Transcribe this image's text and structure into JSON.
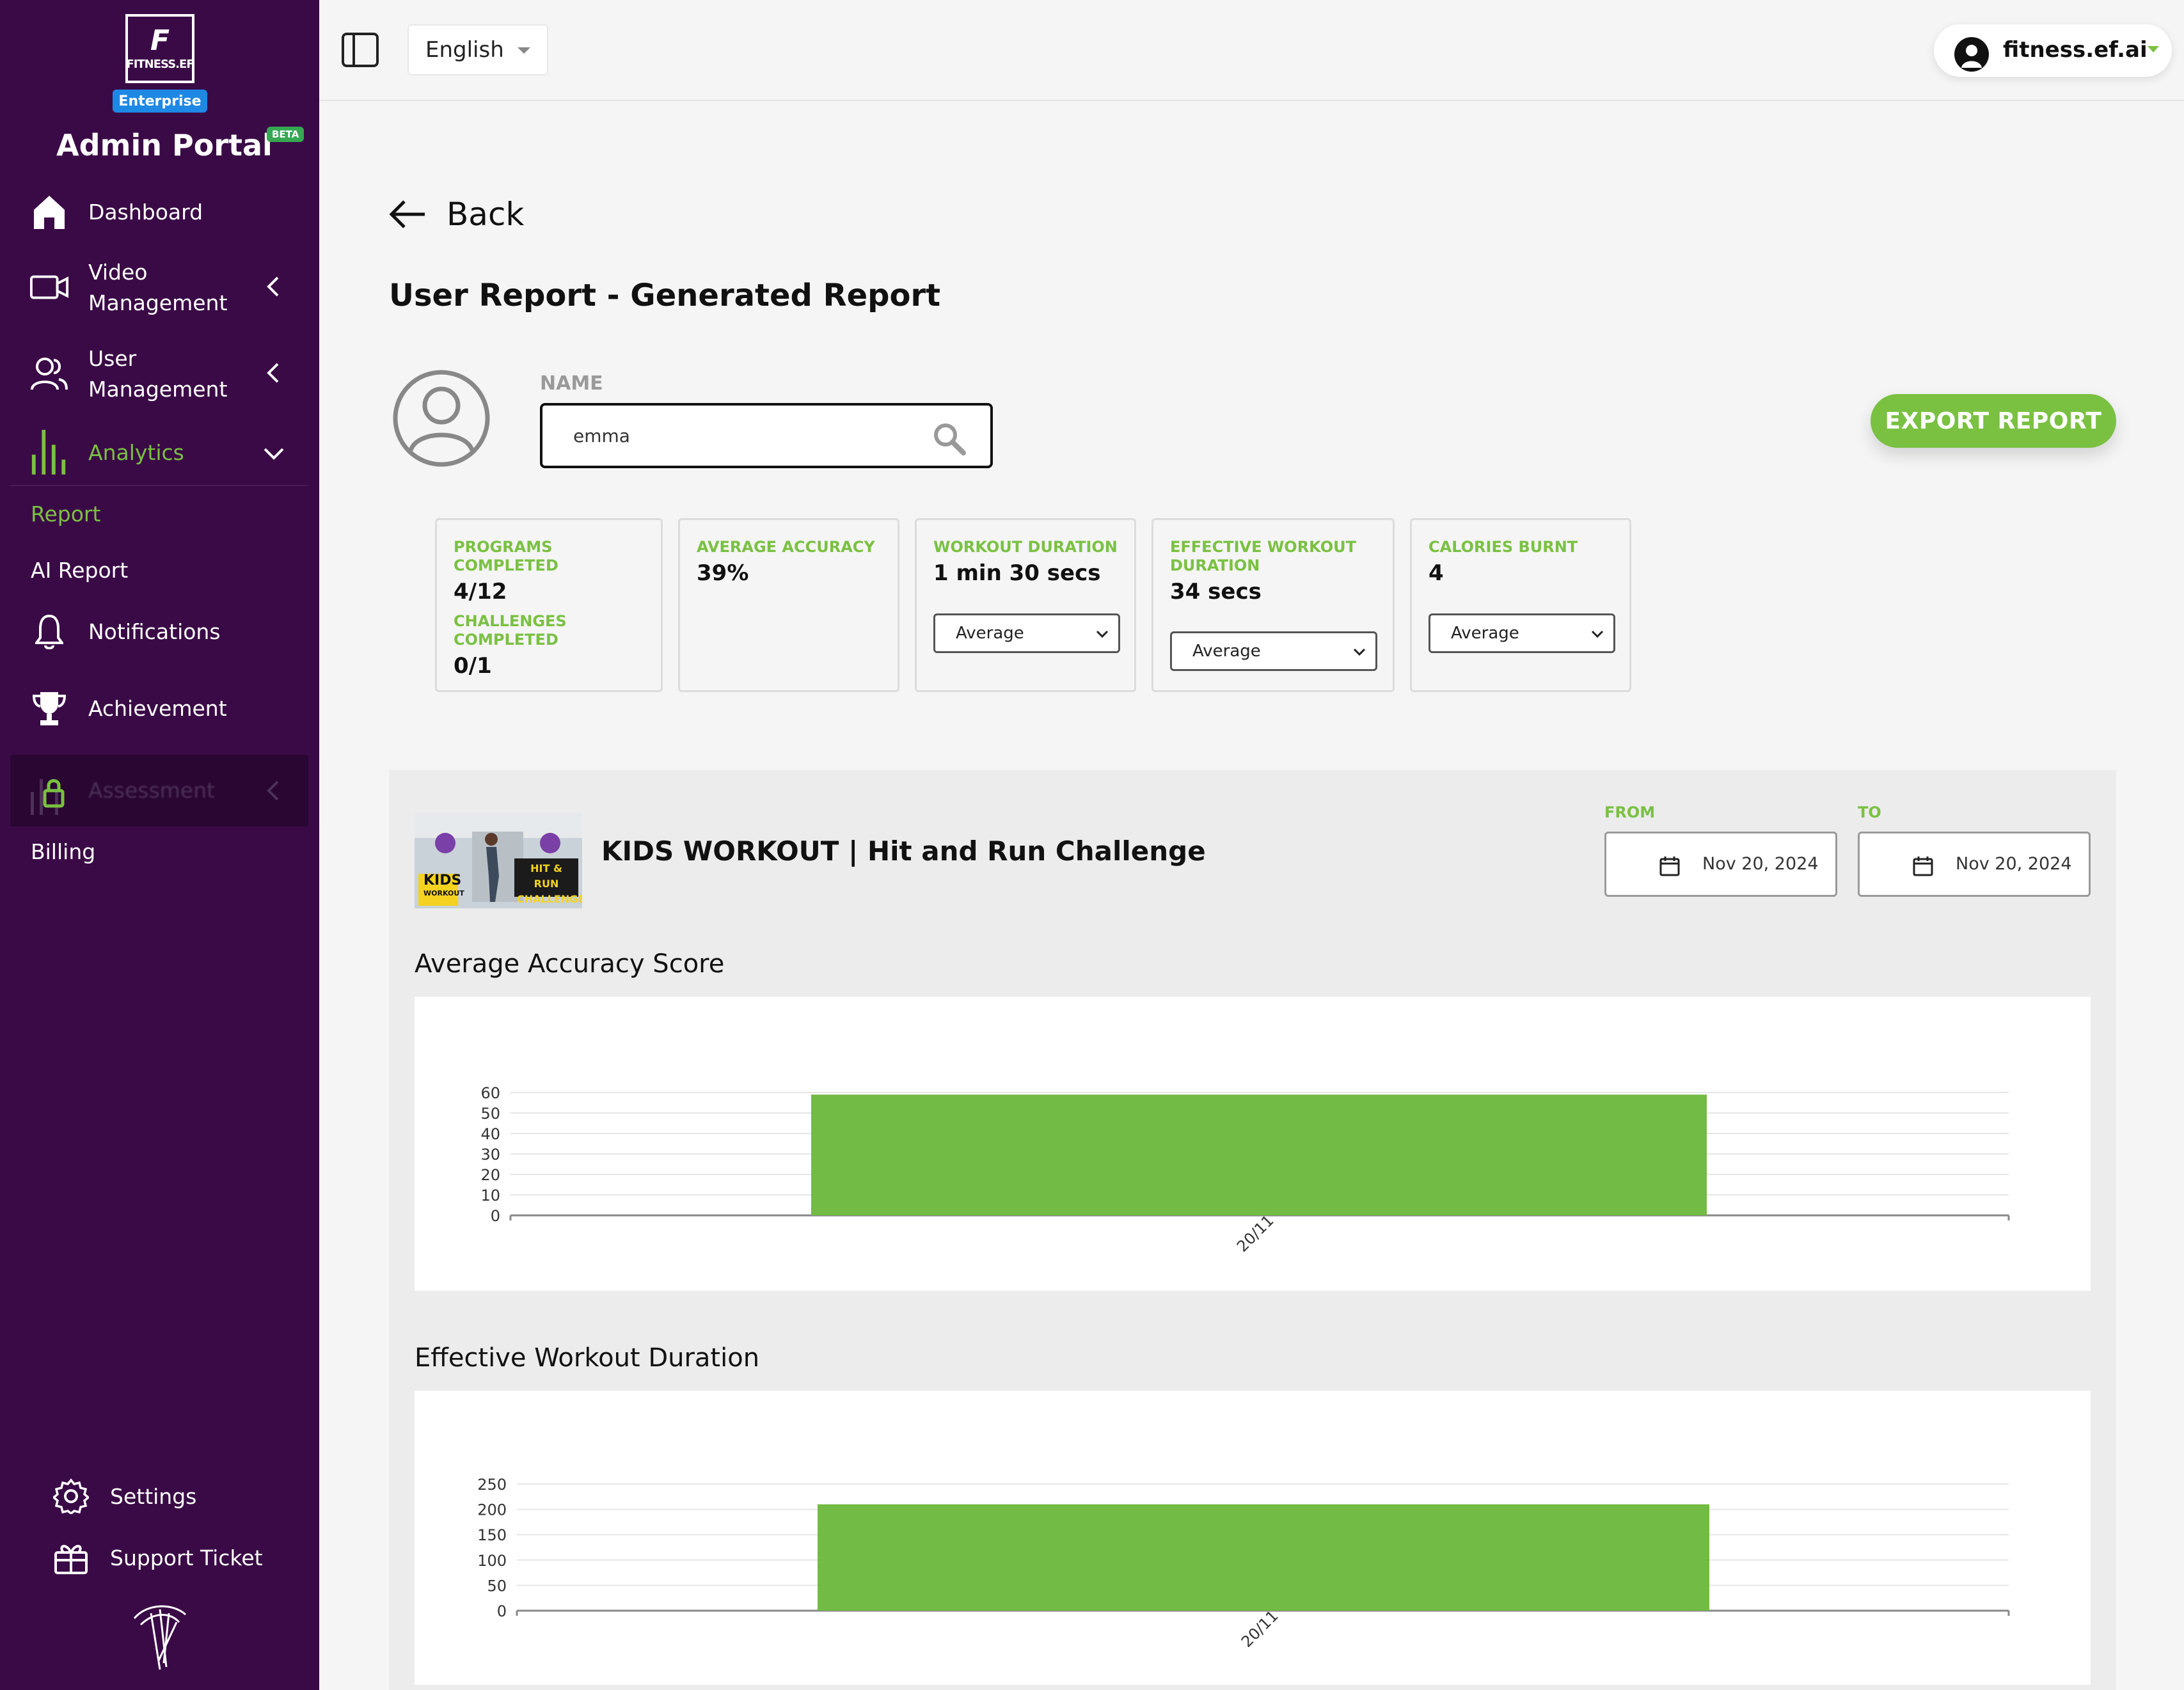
{
  "sidebar": {
    "logo_letter": "F",
    "logo_text": "FITNESS.EF",
    "enterprise_badge": "Enterprise",
    "portal_title": "Admin Portal",
    "beta_badge": "BETA",
    "items": [
      {
        "label": "Dashboard",
        "icon": "home-icon"
      },
      {
        "label": "Video\nManagement",
        "icon": "video-camera-icon"
      },
      {
        "label": "User\nManagement",
        "icon": "users-icon"
      },
      {
        "label": "Analytics",
        "icon": "bar-chart-icon"
      },
      {
        "label": "Report"
      },
      {
        "label": "AI Report"
      },
      {
        "label": "Notifications",
        "icon": "bell-icon"
      },
      {
        "label": "Achievement",
        "icon": "trophy-icon"
      },
      {
        "label": "Assessment",
        "icon": "lock-icon"
      },
      {
        "label": "Billing"
      }
    ],
    "bottom_items": [
      {
        "label": "Settings",
        "icon": "gear-icon"
      },
      {
        "label": "Support Ticket",
        "icon": "gift-icon"
      }
    ],
    "accent_color": "#7ac142",
    "bg_color": "#3a0a46"
  },
  "topbar": {
    "language": "English",
    "account_name": "fitness.ef.ai"
  },
  "main": {
    "back_label": "Back",
    "page_title": "User Report - Generated Report",
    "name_label": "NAME",
    "name_value": "emma",
    "export_label": "EXPORT REPORT",
    "stats": {
      "programs_label": "PROGRAMS COMPLETED",
      "programs_value": "4/12",
      "challenges_label": "CHALLENGES COMPLETED",
      "challenges_value": "0/1",
      "accuracy_label": "AVERAGE ACCURACY",
      "accuracy_value": "39%",
      "duration_label": "WORKOUT DURATION",
      "duration_value": "1 min 30 secs",
      "duration_select": "Average",
      "effective_label": "EFFECTIVE WORKOUT DURATION",
      "effective_value": "34 secs",
      "effective_select": "Average",
      "calories_label": "CALORIES BURNT",
      "calories_value": "4",
      "calories_select": "Average"
    },
    "report": {
      "workout_title": "KIDS WORKOUT | Hit and Run Challenge",
      "thumb_kids": "KIDS",
      "thumb_kids_sub": "WORKOUT",
      "thumb_challenge": "HIT & RUN\nCHALLENGE",
      "from_label": "FROM",
      "from_date": "Nov 20, 2024",
      "to_label": "TO",
      "to_date": "Nov 20, 2024"
    }
  },
  "chart_data": [
    {
      "type": "bar",
      "title": "Average Accuracy Score",
      "categories": [
        "20/11"
      ],
      "values": [
        59
      ],
      "yticks": [
        0,
        10,
        20,
        30,
        40,
        50,
        60
      ],
      "ylim": [
        0,
        60
      ],
      "grid": true,
      "color": "#72bb44"
    },
    {
      "type": "bar",
      "title": "Effective Workout Duration",
      "categories": [
        "20/11"
      ],
      "values": [
        210
      ],
      "yticks": [
        0,
        50,
        100,
        150,
        200,
        250
      ],
      "ylim": [
        0,
        250
      ],
      "grid": true,
      "color": "#72bb44"
    }
  ]
}
